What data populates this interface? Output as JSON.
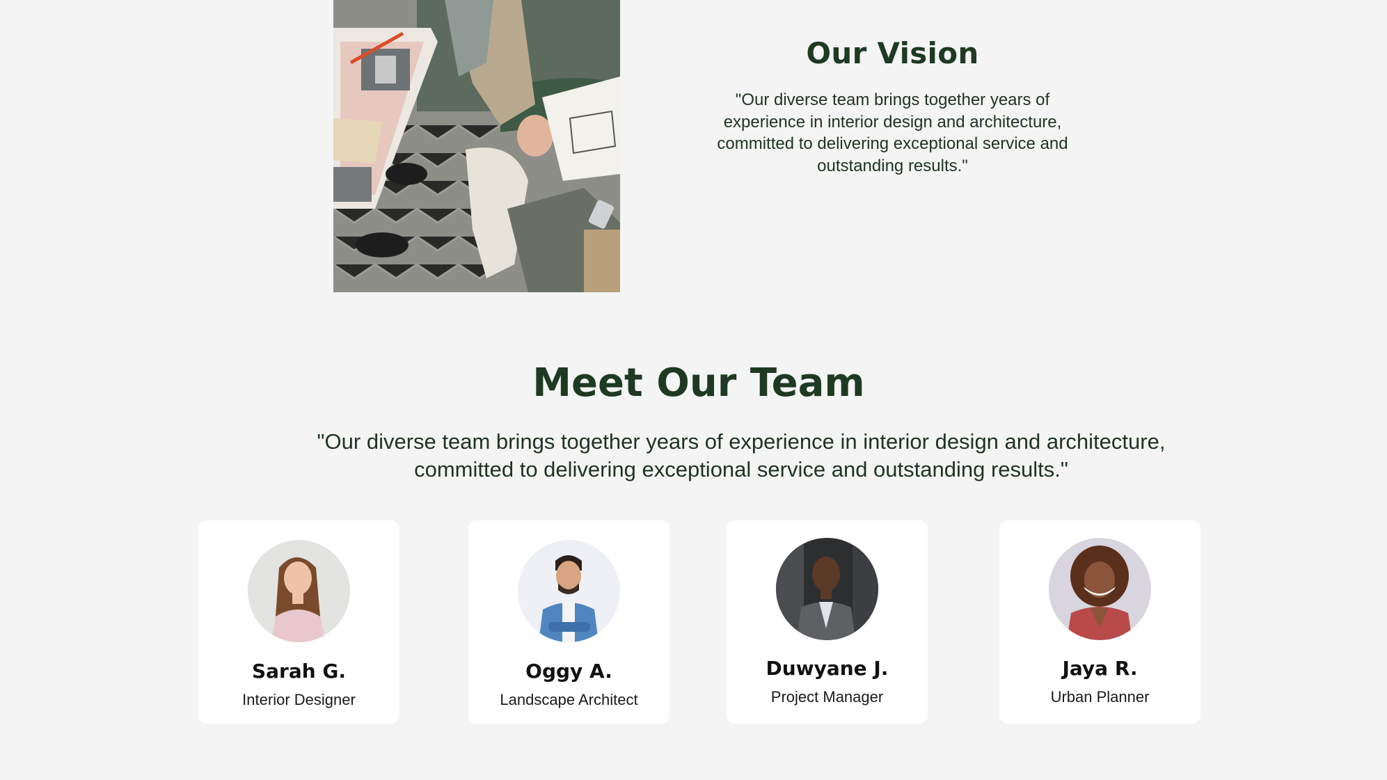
{
  "vision": {
    "title": "Our Vision",
    "text": "\"Our diverse team brings together years of experience in interior design and architecture, committed to delivering exceptional service and outstanding results.\""
  },
  "team": {
    "title": "Meet Our Team",
    "text": "\"Our diverse team brings together years of experience in interior design and architecture, committed to delivering exceptional service and outstanding results.\"",
    "members": [
      {
        "name": "Sarah G.",
        "role": "Interior Designer"
      },
      {
        "name": "Oggy A.",
        "role": "Landscape Architect"
      },
      {
        "name": "Duwyane J.",
        "role": "Project Manager"
      },
      {
        "name": "Jaya R.",
        "role": "Urban Planner"
      }
    ]
  },
  "colors": {
    "background": "#f4f4f4",
    "heading": "#1e3a22",
    "body_text": "#1f3322",
    "card": "#ffffff"
  }
}
